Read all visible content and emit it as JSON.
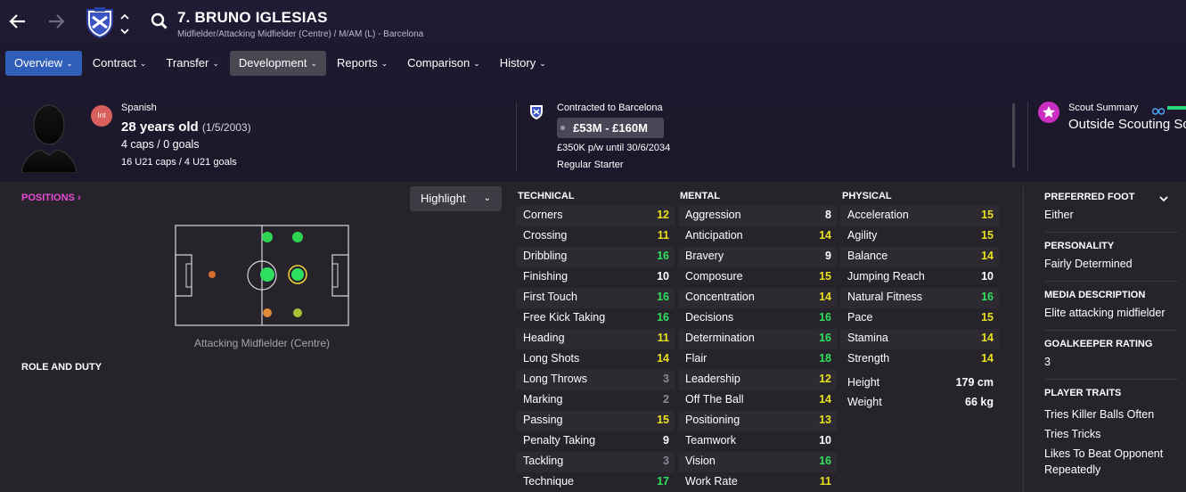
{
  "header": {
    "player_name": "7. BRUNO IGLESIAS",
    "player_sub": "Midfielder/Attacking Midfielder (Centre) / M/AM (L) - Barcelona",
    "back_icon": "arrow-left-icon",
    "forward_icon": "arrow-right-icon",
    "search_icon": "search-icon"
  },
  "tabs": [
    {
      "label": "Overview",
      "state": "active"
    },
    {
      "label": "Contract",
      "state": "normal"
    },
    {
      "label": "Transfer",
      "state": "normal"
    },
    {
      "label": "Development",
      "state": "highlighted"
    },
    {
      "label": "Reports",
      "state": "normal"
    },
    {
      "label": "Comparison",
      "state": "normal"
    },
    {
      "label": "History",
      "state": "normal"
    }
  ],
  "info": {
    "int_badge": "Int",
    "nationality": "Spanish",
    "age": "28 years old",
    "dob": "(1/5/2003)",
    "caps": "4 caps / 0 goals",
    "u21": "16 U21 caps / 4 U21 goals"
  },
  "contract": {
    "label": "Contracted to Barcelona",
    "value": "£53M - £160M",
    "wage": "£350K p/w until 30/6/2034",
    "status": "Regular Starter"
  },
  "scout": {
    "label": "Scout Summary",
    "value": "Outside Scouting Scope"
  },
  "positions": {
    "link": "POSITIONS",
    "highlight": "Highlight",
    "caption": "Attacking Midfielder (Centre)",
    "role_duty": "ROLE AND DUTY"
  },
  "technical": {
    "title": "TECHNICAL",
    "rows": [
      {
        "name": "Corners",
        "value": "12"
      },
      {
        "name": "Crossing",
        "value": "11"
      },
      {
        "name": "Dribbling",
        "value": "16"
      },
      {
        "name": "Finishing",
        "value": "10"
      },
      {
        "name": "First Touch",
        "value": "16"
      },
      {
        "name": "Free Kick Taking",
        "value": "16"
      },
      {
        "name": "Heading",
        "value": "11"
      },
      {
        "name": "Long Shots",
        "value": "14"
      },
      {
        "name": "Long Throws",
        "value": "3"
      },
      {
        "name": "Marking",
        "value": "2"
      },
      {
        "name": "Passing",
        "value": "15"
      },
      {
        "name": "Penalty Taking",
        "value": "9"
      },
      {
        "name": "Tackling",
        "value": "3"
      },
      {
        "name": "Technique",
        "value": "17"
      }
    ]
  },
  "mental": {
    "title": "MENTAL",
    "rows": [
      {
        "name": "Aggression",
        "value": "8"
      },
      {
        "name": "Anticipation",
        "value": "14"
      },
      {
        "name": "Bravery",
        "value": "9"
      },
      {
        "name": "Composure",
        "value": "15"
      },
      {
        "name": "Concentration",
        "value": "14"
      },
      {
        "name": "Decisions",
        "value": "16"
      },
      {
        "name": "Determination",
        "value": "16"
      },
      {
        "name": "Flair",
        "value": "18"
      },
      {
        "name": "Leadership",
        "value": "12"
      },
      {
        "name": "Off The Ball",
        "value": "14"
      },
      {
        "name": "Positioning",
        "value": "13"
      },
      {
        "name": "Teamwork",
        "value": "10"
      },
      {
        "name": "Vision",
        "value": "16"
      },
      {
        "name": "Work Rate",
        "value": "11"
      }
    ]
  },
  "physical": {
    "title": "PHYSICAL",
    "rows": [
      {
        "name": "Acceleration",
        "value": "15"
      },
      {
        "name": "Agility",
        "value": "15"
      },
      {
        "name": "Balance",
        "value": "14"
      },
      {
        "name": "Jumping Reach",
        "value": "10"
      },
      {
        "name": "Natural Fitness",
        "value": "16"
      },
      {
        "name": "Pace",
        "value": "15"
      },
      {
        "name": "Stamina",
        "value": "14"
      },
      {
        "name": "Strength",
        "value": "14"
      }
    ],
    "height_label": "Height",
    "height": "179 cm",
    "weight_label": "Weight",
    "weight": "66 kg"
  },
  "side": {
    "foot_label": "PREFERRED FOOT",
    "foot": "Either",
    "personality_label": "PERSONALITY",
    "personality": "Fairly Determined",
    "media_label": "MEDIA DESCRIPTION",
    "media": "Elite attacking midfielder",
    "gk_label": "GOALKEEPER RATING",
    "gk": "3",
    "traits_label": "PLAYER TRAITS",
    "traits": [
      "Tries Killer Balls Often",
      "Tries Tricks",
      "Likes To Beat Opponent Repeatedly"
    ]
  },
  "colors": {
    "accent": "#2f5fb8",
    "positions_link": "#e84cd7",
    "attr_white": "#ffffff",
    "attr_yellow": "#e9e11d",
    "attr_green": "#2fe05e",
    "attr_grey": "#8b8794"
  }
}
